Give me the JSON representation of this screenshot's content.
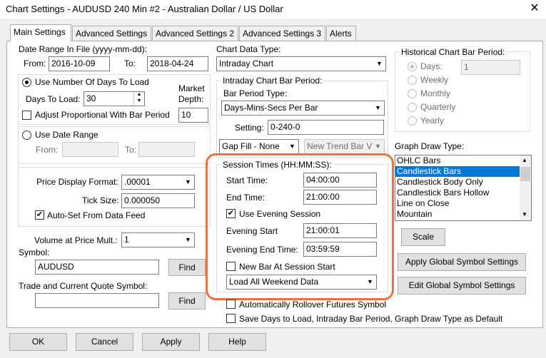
{
  "window": {
    "title": "Chart Settings - AUDUSD  240 Min   #2 - Australian Dollar / US Dollar",
    "close": "✕"
  },
  "tabs": [
    "Main Settings",
    "Advanced Settings",
    "Advanced Settings 2",
    "Advanced Settings 3",
    "Alerts"
  ],
  "date_range": {
    "label": "Date Range In File (yyyy-mm-dd):",
    "from_label": "From:",
    "from": "2016-10-09",
    "to_label": "To:",
    "to": "2018-04-24"
  },
  "days_group": {
    "use_days_label": "Use Number Of Days To Load",
    "days_to_load_label": "Days To Load:",
    "days_to_load": "30",
    "market_depth_label_1": "Market",
    "market_depth_label_2": "Depth:",
    "market_depth": "10",
    "adjust_label": "Adjust Proportional With Bar Period"
  },
  "date_range_group": {
    "label": "Use Date Range",
    "from_label": "From:",
    "to_label": "To:"
  },
  "price": {
    "display_format_label": "Price Display Format:",
    "display_format": ".00001",
    "tick_size_label": "Tick Size:",
    "tick_size": "0.000050",
    "auto_set_label": "Auto-Set From Data Feed"
  },
  "volume": {
    "label": "Volume at Price Mult.:",
    "value": "1"
  },
  "symbol": {
    "label": "Symbol:",
    "value": "AUDUSD",
    "find": "Find"
  },
  "trade_symbol": {
    "label": "Trade and Current Quote Symbol:",
    "value": "",
    "find": "Find"
  },
  "chart_data_type": {
    "label": "Chart Data Type:",
    "value": "Intraday Chart"
  },
  "intraday": {
    "group_label": "Intraday Chart Bar Period:",
    "bar_period_type_label": "Bar Period Type:",
    "bar_period_type": "Days-Mins-Secs Per Bar",
    "setting_label": "Setting:",
    "setting": "0-240-0",
    "gap_fill": "Gap Fill - None",
    "new_trend_bar": "New Trend Bar V"
  },
  "session": {
    "group_label": "Session Times (HH:MM:SS):",
    "start_label": "Start Time:",
    "start": "04:00:00",
    "end_label": "End Time:",
    "end": "21:00:00",
    "use_evening_label": "Use Evening Session",
    "evening_start_label": "Evening Start",
    "evening_start": "21:00:01",
    "evening_end_label": "Evening End Time:",
    "evening_end": "03:59:59",
    "new_bar_label": "New Bar At Session Start",
    "weekend": "Load All Weekend Data"
  },
  "rollover_label": "Automatically Rollover Futures Symbol",
  "save_days_label": "Save Days to Load, Intraday Bar Period, Graph Draw Type as Default",
  "historical": {
    "group_label": "Historical Chart Bar Period:",
    "days_label": "Days:",
    "days_value": "1",
    "weekly": "Weekly",
    "monthly": "Monthly",
    "quarterly": "Quarterly",
    "yearly": "Yearly"
  },
  "graph_draw": {
    "label": "Graph Draw Type:",
    "items": [
      "OHLC Bars",
      "Candlestick Bars",
      "Candlestick Body Only",
      "Candlestick Bars Hollow",
      "Line on Close",
      "Mountain"
    ],
    "selected": "Candlestick Bars"
  },
  "buttons": {
    "scale": "Scale",
    "apply_global": "Apply Global Symbol Settings",
    "edit_global": "Edit Global Symbol Settings",
    "ok": "OK",
    "cancel": "Cancel",
    "apply": "Apply",
    "help": "Help"
  },
  "colors": {
    "accent": "#0078d7",
    "highlight": "#e9733b"
  }
}
